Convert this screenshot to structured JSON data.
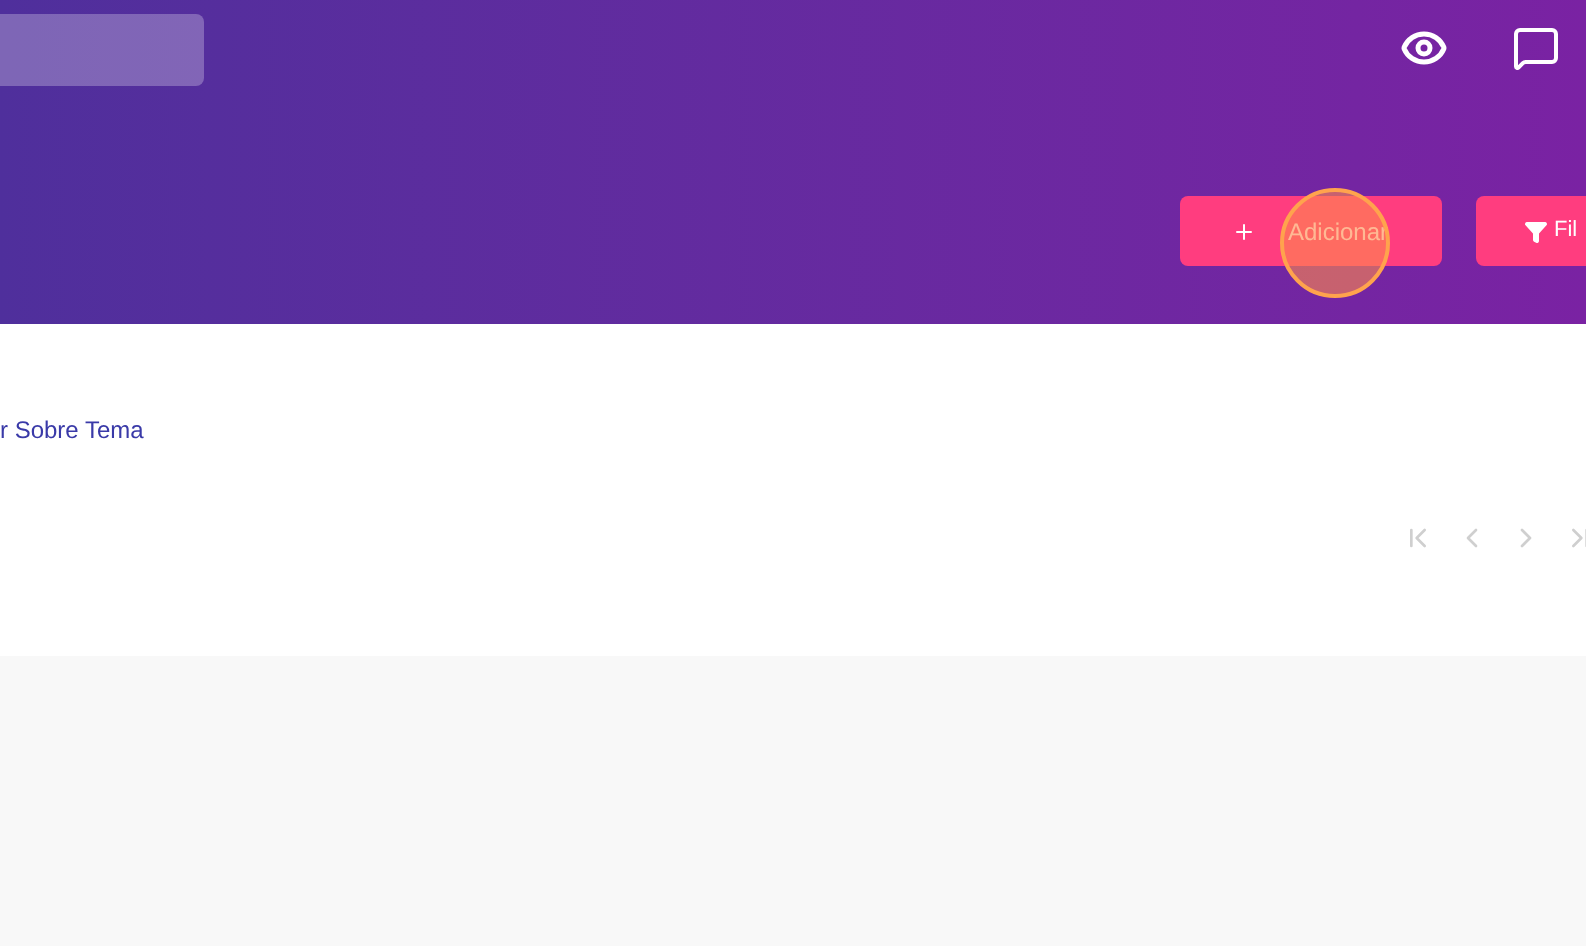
{
  "header": {
    "buttons": [
      {
        "kind": "add",
        "label": "Adicionar"
      },
      {
        "kind": "filter",
        "label": "Fil"
      }
    ]
  },
  "content": {
    "link": "r Sobre Tema"
  }
}
